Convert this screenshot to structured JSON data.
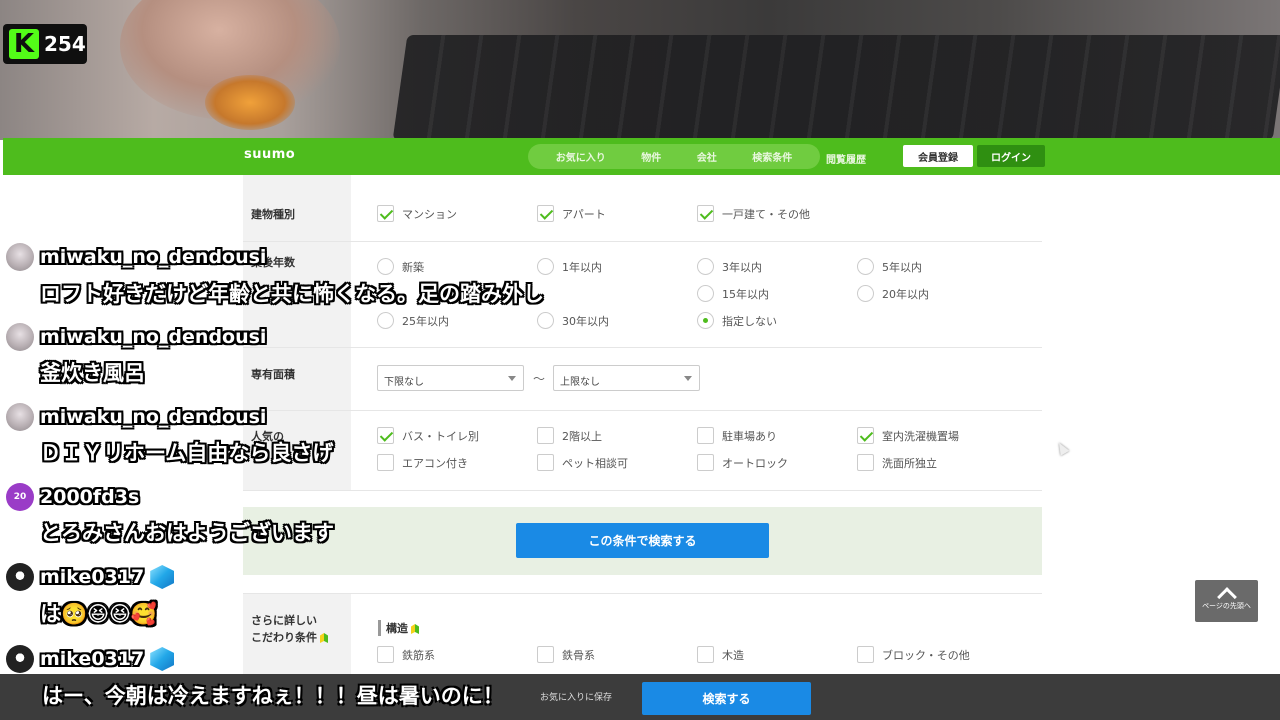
{
  "kick": {
    "viewer_count": "254"
  },
  "suumo": {
    "logo": "suumo",
    "nav": {
      "favorites": "お気に入り",
      "property": "物件",
      "company": "会社",
      "search_cond": "検索条件",
      "history": "閲覧履歴"
    },
    "register": "会員登録",
    "login": "ログイン"
  },
  "form": {
    "building_type": {
      "label": "建物種別",
      "options": [
        {
          "text": "マンション",
          "checked": true
        },
        {
          "text": "アパート",
          "checked": true
        },
        {
          "text": "一戸建て・その他",
          "checked": true
        }
      ]
    },
    "age": {
      "label": "築後年数",
      "options": [
        "新築",
        "1年以内",
        "3年以内",
        "5年以内",
        "15年以内",
        "20年以内",
        "25年以内",
        "30年以内",
        "指定しない"
      ],
      "selected": "指定しない"
    },
    "area": {
      "label": "専有面積",
      "min": "下限なし",
      "tilde": "〜",
      "max": "上限なし"
    },
    "popular": {
      "label": "人気の",
      "options": [
        {
          "text": "バス・トイレ別",
          "checked": true
        },
        {
          "text": "2階以上",
          "checked": false
        },
        {
          "text": "駐車場あり",
          "checked": false
        },
        {
          "text": "室内洗濯機置場",
          "checked": true
        },
        {
          "text": "エアコン付き",
          "checked": false
        },
        {
          "text": "ペット相談可",
          "checked": false
        },
        {
          "text": "オートロック",
          "checked": false
        },
        {
          "text": "洗面所独立",
          "checked": false
        }
      ]
    },
    "search_button": "この条件で検索する",
    "detail": {
      "label_line1": "さらに詳しい",
      "label_line2": "こだわり条件",
      "structure_title": "構造",
      "structure_options": [
        "鉄筋系",
        "鉄骨系",
        "木造",
        "ブロック・その他"
      ]
    }
  },
  "to_top": {
    "label": "ページの先頭へ"
  },
  "bottom_bar": {
    "favorite_save": "お気に入りに保存",
    "search": "検索する"
  },
  "chat": [
    {
      "user": "miwaku_no_dendousi",
      "text": "ロフト好きだけど年齢と共に怖くなる。足の踏み外し"
    },
    {
      "user": "miwaku_no_dendousi",
      "text": "釜炊き風呂"
    },
    {
      "user": "miwaku_no_dendousi",
      "text": "ＤＩＹリホーム自由なら良さげ"
    },
    {
      "user": "2000fd3s",
      "avatar_text": "20",
      "text": "とろみさんおはようございます"
    },
    {
      "user": "mike0317",
      "text": "は🥺😆😆🥰"
    },
    {
      "user": "mike0317",
      "text": "はー、今朝は冷えますねぇ！！！昼は暑いのに！"
    }
  ]
}
